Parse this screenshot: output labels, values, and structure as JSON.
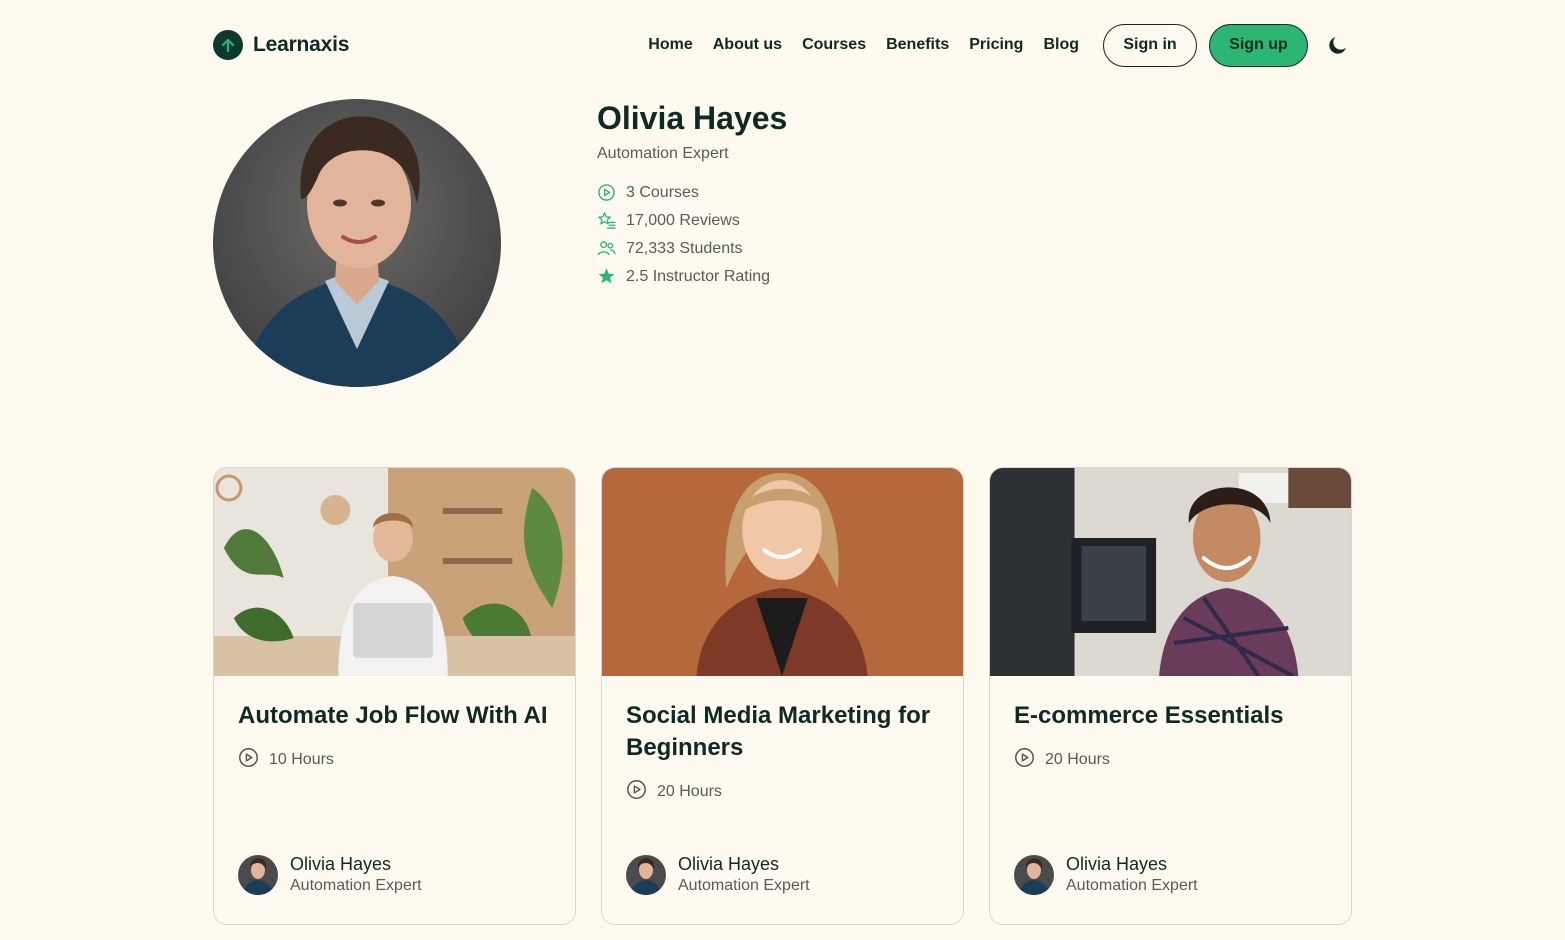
{
  "brand": {
    "name": "Learnaxis",
    "logo_icon": "arrow-up-icon"
  },
  "nav": {
    "links": [
      "Home",
      "About us",
      "Courses",
      "Benefits",
      "Pricing",
      "Blog"
    ],
    "sign_in": "Sign in",
    "sign_up": "Sign up",
    "theme_icon": "moon-icon"
  },
  "profile": {
    "name": "Olivia Hayes",
    "title": "Automation Expert",
    "stats": [
      {
        "icon": "play-circle-icon",
        "text": "3 Courses"
      },
      {
        "icon": "star-list-icon",
        "text": "17,000 Reviews"
      },
      {
        "icon": "users-icon",
        "text": "72,333 Students"
      },
      {
        "icon": "star-icon",
        "text": "2.5 Instructor Rating"
      }
    ]
  },
  "courses": [
    {
      "title": "Automate Job Flow With AI",
      "hours": "10 Hours",
      "author": "Olivia Hayes",
      "author_role": "Automation Expert"
    },
    {
      "title": "Social Media Marketing for Beginners",
      "hours": "20 Hours",
      "author": "Olivia Hayes",
      "author_role": "Automation Expert"
    },
    {
      "title": "E-commerce Essentials",
      "hours": "20 Hours",
      "author": "Olivia Hayes",
      "author_role": "Automation Expert"
    }
  ],
  "colors": {
    "background": "#fefaf0",
    "primary_dark": "#0e2a22",
    "accent_green": "#2bb673",
    "muted_text": "#555d58"
  }
}
